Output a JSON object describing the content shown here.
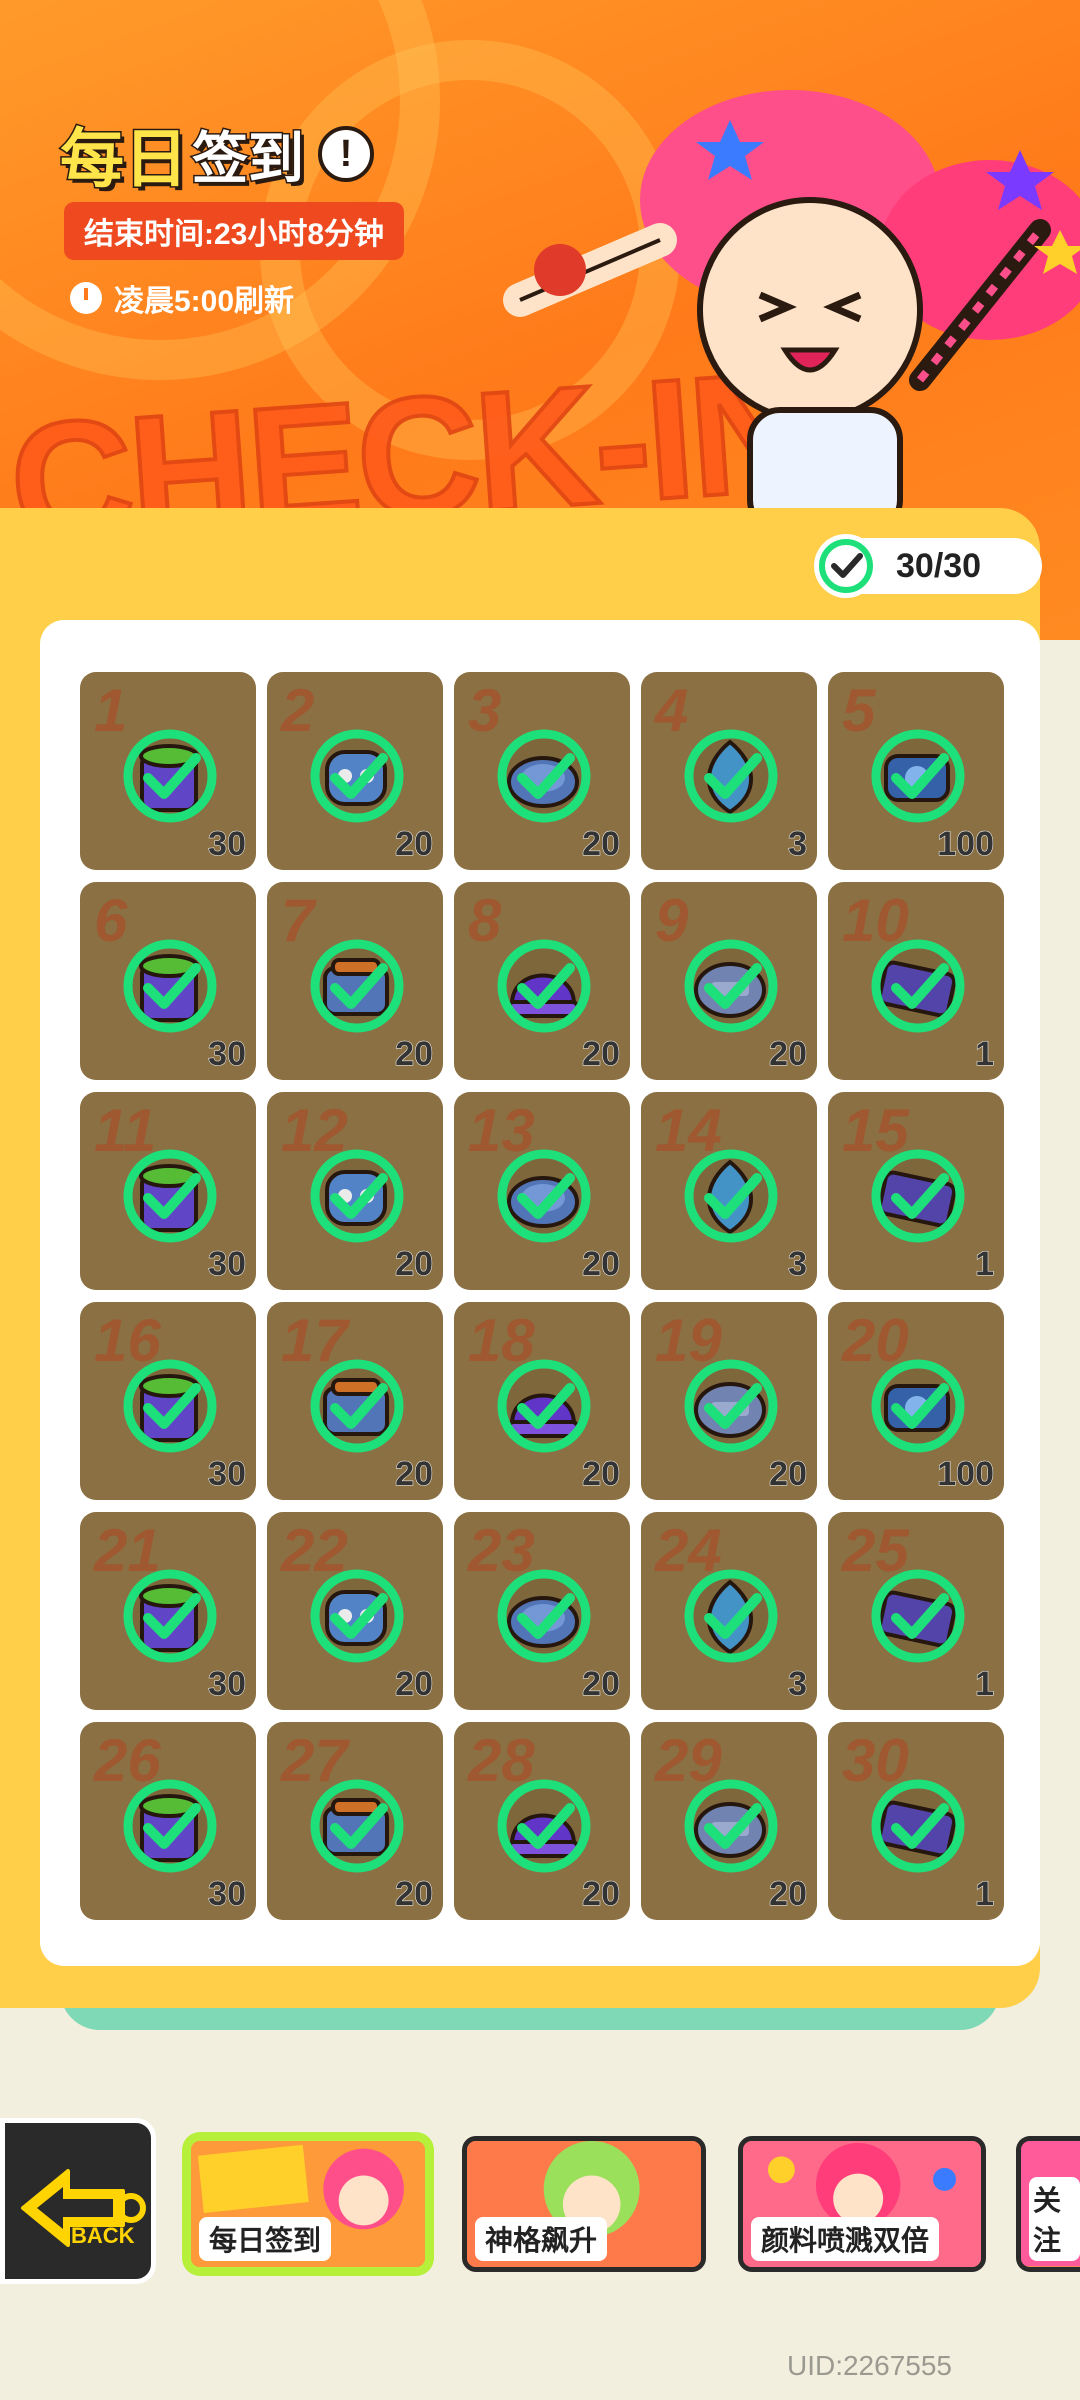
{
  "header": {
    "title_part1": "每日",
    "title_part2": "签到",
    "info_icon": "exclamation-icon",
    "end_time": "结束时间:23小时8分钟",
    "refresh_text": "凌晨5:00刷新",
    "banner_text": "CHECK-IN"
  },
  "progress": {
    "text": "30/30",
    "done": 30,
    "total": 30
  },
  "colors": {
    "banner": "#ff7a1a",
    "panel": "#ffcf4a",
    "cell": "#8a7042",
    "check": "#1ee07a",
    "active_tab": "#b6f03a"
  },
  "days": [
    {
      "day": "1",
      "qty": "30",
      "item": "paint-bucket-icon",
      "checked": true
    },
    {
      "day": "2",
      "qty": "20",
      "item": "robot-head-icon",
      "checked": true
    },
    {
      "day": "3",
      "qty": "20",
      "item": "coin-icon",
      "checked": true
    },
    {
      "day": "4",
      "qty": "3",
      "item": "gem-icon",
      "checked": true
    },
    {
      "day": "5",
      "qty": "100",
      "item": "token-icon",
      "checked": true
    },
    {
      "day": "6",
      "qty": "30",
      "item": "paint-bucket-icon",
      "checked": true
    },
    {
      "day": "7",
      "qty": "20",
      "item": "paint-box-icon",
      "checked": true
    },
    {
      "day": "8",
      "qty": "20",
      "item": "purple-cap-icon",
      "checked": true
    },
    {
      "day": "9",
      "qty": "20",
      "item": "coupon-coin-icon",
      "checked": true
    },
    {
      "day": "10",
      "qty": "1",
      "item": "ticket-icon",
      "checked": true
    },
    {
      "day": "11",
      "qty": "30",
      "item": "paint-bucket-icon",
      "checked": true
    },
    {
      "day": "12",
      "qty": "20",
      "item": "robot-head-icon",
      "checked": true
    },
    {
      "day": "13",
      "qty": "20",
      "item": "coin-icon",
      "checked": true
    },
    {
      "day": "14",
      "qty": "3",
      "item": "gem-icon",
      "checked": true
    },
    {
      "day": "15",
      "qty": "1",
      "item": "ticket-icon",
      "checked": true
    },
    {
      "day": "16",
      "qty": "30",
      "item": "paint-bucket-icon",
      "checked": true
    },
    {
      "day": "17",
      "qty": "20",
      "item": "paint-box-icon",
      "checked": true
    },
    {
      "day": "18",
      "qty": "20",
      "item": "purple-cap-icon",
      "checked": true
    },
    {
      "day": "19",
      "qty": "20",
      "item": "coupon-coin-icon",
      "checked": true
    },
    {
      "day": "20",
      "qty": "100",
      "item": "token-icon",
      "checked": true
    },
    {
      "day": "21",
      "qty": "30",
      "item": "paint-bucket-icon",
      "checked": true
    },
    {
      "day": "22",
      "qty": "20",
      "item": "robot-head-icon",
      "checked": true
    },
    {
      "day": "23",
      "qty": "20",
      "item": "coin-icon",
      "checked": true
    },
    {
      "day": "24",
      "qty": "3",
      "item": "gem-icon",
      "checked": true
    },
    {
      "day": "25",
      "qty": "1",
      "item": "ticket-icon",
      "checked": true
    },
    {
      "day": "26",
      "qty": "30",
      "item": "paint-bucket-icon",
      "checked": true
    },
    {
      "day": "27",
      "qty": "20",
      "item": "paint-box-icon",
      "checked": true
    },
    {
      "day": "28",
      "qty": "20",
      "item": "purple-cap-icon",
      "checked": true
    },
    {
      "day": "29",
      "qty": "20",
      "item": "coupon-coin-icon",
      "checked": true
    },
    {
      "day": "30",
      "qty": "1",
      "item": "ticket-icon",
      "checked": true
    }
  ],
  "nav": {
    "back_label": "BACK",
    "tabs": [
      {
        "label": "每日签到",
        "active": true
      },
      {
        "label": "神格飙升",
        "active": false
      },
      {
        "label": "颜料喷溅双倍",
        "active": false
      },
      {
        "label": "关注",
        "active": false
      }
    ]
  },
  "uid": "UID:2267555"
}
